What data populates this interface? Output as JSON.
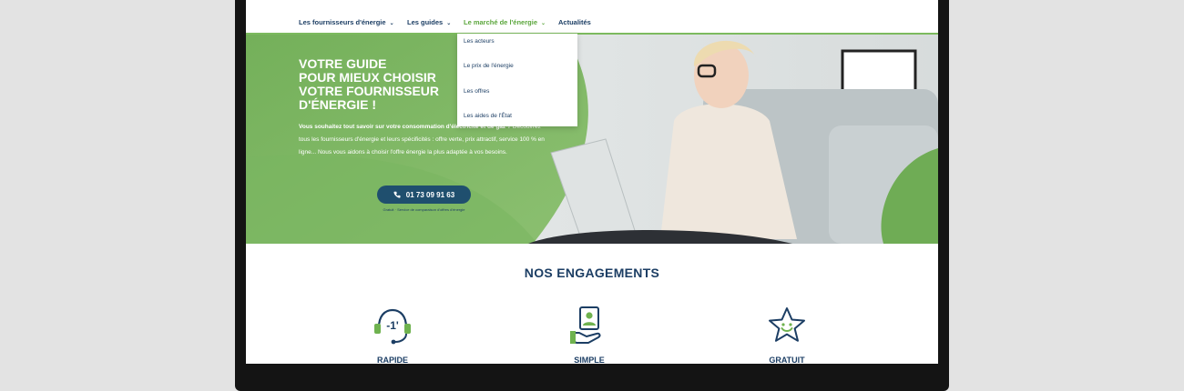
{
  "nav": {
    "items": [
      {
        "label": "Les fournisseurs d'énergie",
        "chevron": "⌄"
      },
      {
        "label": "Les guides",
        "chevron": "⌄"
      },
      {
        "label": "Le marché de l'énergie",
        "chevron": "⌄"
      },
      {
        "label": "Actualités",
        "chevron": ""
      }
    ]
  },
  "dropdown": {
    "items": [
      "Les acteurs",
      "Le prix de l'énergie",
      "Les offres",
      "Les aides de l'État"
    ]
  },
  "hero": {
    "title_lines": [
      "VOTRE GUIDE",
      "POUR MIEUX CHOISIR",
      "VOTRE FOURNISSEUR",
      "D'ÉNERGIE !"
    ],
    "text_bold": "Vous souhaitez tout savoir sur votre consommation d'électricité et de gaz ?",
    "text": "Découvrez tous les fournisseurs d'énergie et leurs spécificités : offre verte, prix attractif, service 100 % en ligne... Nous vous aidons à choisir l'offre énergie la plus adaptée à vos besoins.",
    "phone": "01 73 09 91 63",
    "phone_note": "Gratuit · Service de comparaison d'offres d'énergie"
  },
  "engagements": {
    "title": "NOS ENGAGEMENTS",
    "items": [
      {
        "label": "RAPIDE",
        "icon": "headset-clock-icon",
        "icon_text": "-1'"
      },
      {
        "label": "SIMPLE",
        "icon": "hand-profile-card-icon"
      },
      {
        "label": "GRATUIT",
        "icon": "smiling-star-icon"
      }
    ]
  },
  "colors": {
    "navy": "#1c3e64",
    "green": "#7cba5e",
    "green_dark": "#5ba63c",
    "button": "#1f4f6e"
  }
}
